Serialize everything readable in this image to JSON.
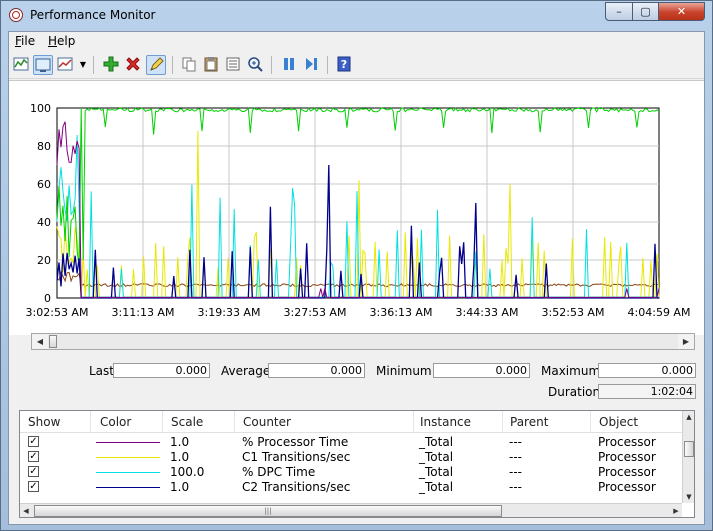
{
  "window": {
    "title": "Performance Monitor",
    "minimize_label": "–",
    "maximize_label": "▢",
    "close_label": "✕"
  },
  "menu": [
    {
      "label": "File",
      "key": "F",
      "rest": "ile"
    },
    {
      "label": "Help",
      "key": "H",
      "rest": "elp"
    }
  ],
  "toolbar": {
    "icons": [
      "change-graph-type-icon",
      "view-current-activity-icon",
      "view-log-data-icon",
      "dropdown-arrow-icon",
      "add-counter-icon",
      "delete-counter-icon",
      "highlight-icon",
      "copy-properties-icon",
      "paste-counter-list-icon",
      "properties-icon",
      "zoom-icon",
      "freeze-display-icon",
      "update-data-icon",
      "help-icon"
    ]
  },
  "chart_data": {
    "type": "line",
    "y_ticks": [
      "100",
      "80",
      "60",
      "40",
      "20",
      "0"
    ],
    "ylim": [
      0,
      100
    ],
    "x_ticks": [
      "3:02:53 AM",
      "3:11:13 AM",
      "3:19:33 AM",
      "3:27:53 AM",
      "3:36:13 AM",
      "3:44:33 AM",
      "3:52:53 AM",
      "4:04:59 AM"
    ],
    "grid": true,
    "series": [
      {
        "color": "#800080"
      },
      {
        "color": "#e8e800"
      },
      {
        "color": "#00e0e0"
      },
      {
        "color": "#00008b"
      },
      {
        "color": "#00d000"
      },
      {
        "color": "#8b4513"
      }
    ]
  },
  "stats": {
    "last_label": "Last",
    "last": "0.000",
    "average_label": "Average",
    "average": "0.000",
    "minimum_label": "Minimum",
    "minimum": "0.000",
    "maximum_label": "Maximum",
    "maximum": "0.000",
    "duration_label": "Duration",
    "duration": "1:02:04"
  },
  "legend": {
    "headers": {
      "show": "Show",
      "color": "Color",
      "scale": "Scale",
      "counter": "Counter",
      "instance": "Instance",
      "parent": "Parent",
      "object": "Object"
    },
    "rows": [
      {
        "color": "#800080",
        "scale": "1.0",
        "counter": "% Processor Time",
        "instance": "_Total",
        "parent": "---",
        "object": "Processor"
      },
      {
        "color": "#e8e800",
        "scale": "1.0",
        "counter": "C1 Transitions/sec",
        "instance": "_Total",
        "parent": "---",
        "object": "Processor"
      },
      {
        "color": "#00e0e0",
        "scale": "100.0",
        "counter": "% DPC Time",
        "instance": "_Total",
        "parent": "---",
        "object": "Processor"
      },
      {
        "color": "#00008b",
        "scale": "1.0",
        "counter": "C2 Transitions/sec",
        "instance": "_Total",
        "parent": "---",
        "object": "Processor"
      }
    ]
  }
}
